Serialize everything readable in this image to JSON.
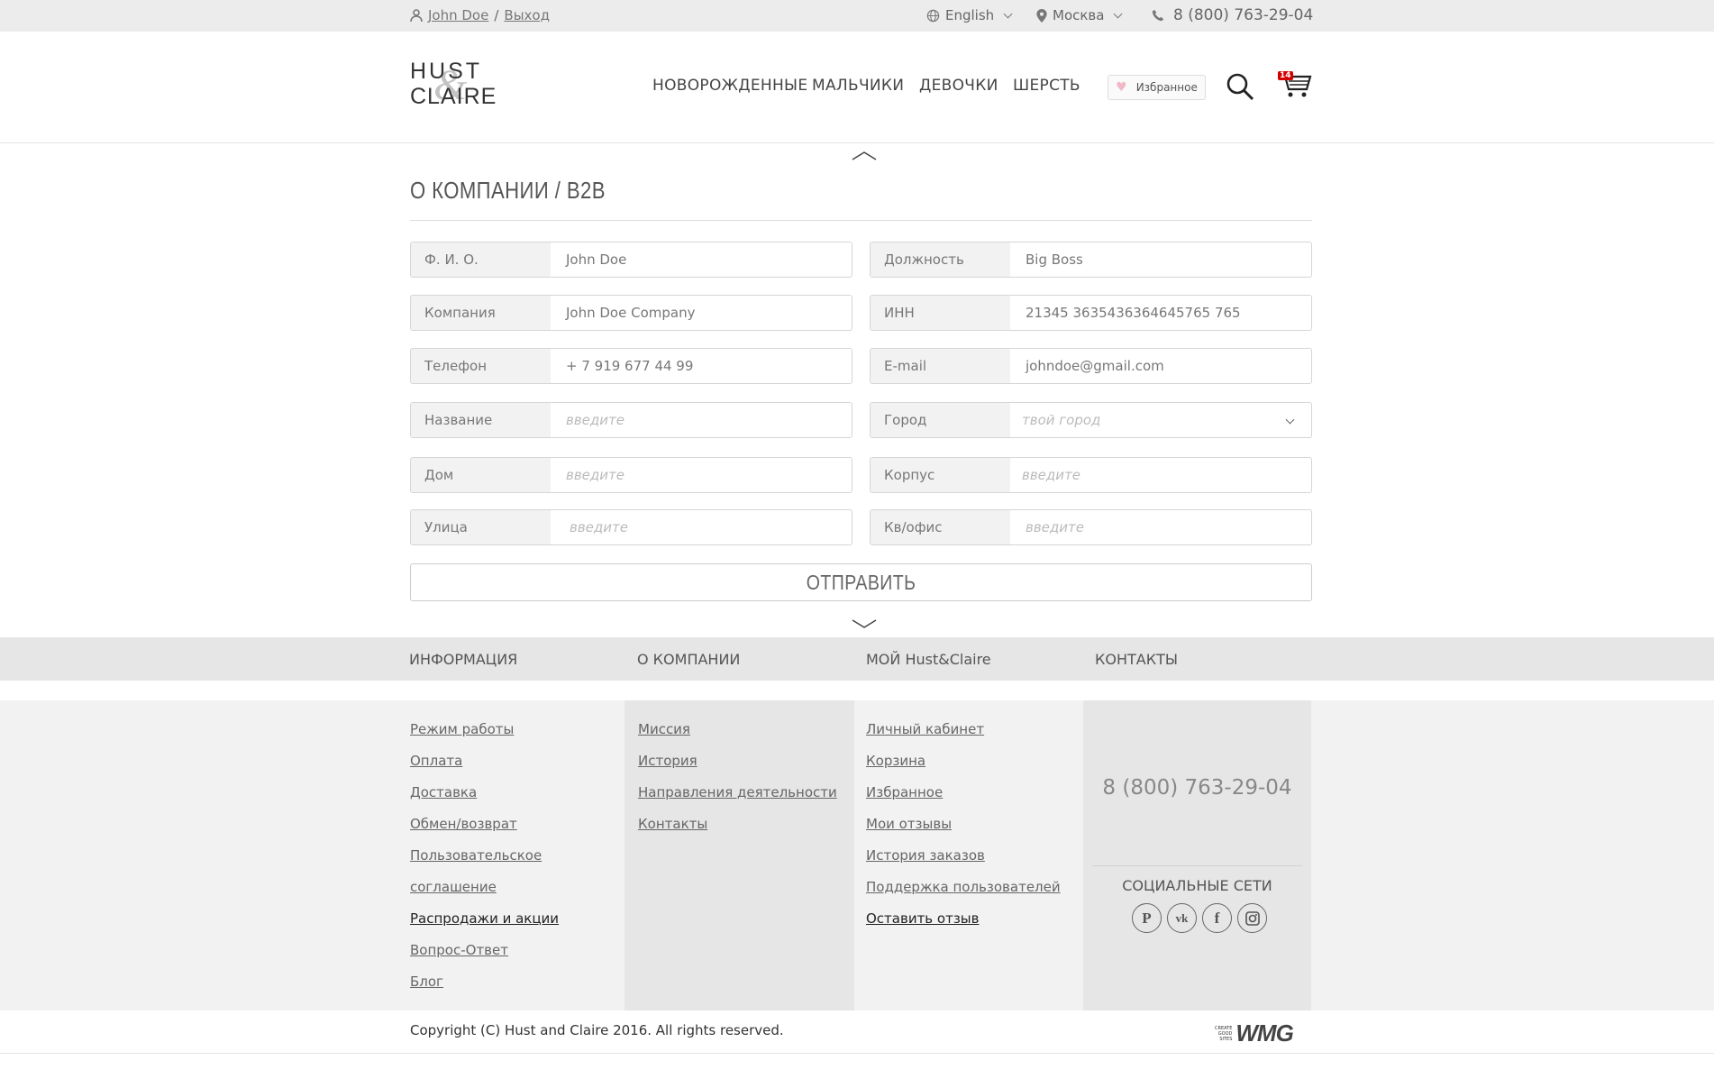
{
  "topbar": {
    "user_name": "John Doe",
    "separator": "/",
    "logout": "Выход",
    "language": "English",
    "city": "Москва",
    "phone": "8 (800) 763-29-04"
  },
  "header": {
    "logo_top": "HUST",
    "logo_amp": "&",
    "logo_bottom": "CLAIRE",
    "nav": [
      "НОВОРОЖДЕННЫЕ",
      "МАЛЬЧИКИ",
      "ДЕВОЧКИ",
      "ШЕРСТЬ"
    ],
    "favorites": "Избранное",
    "cart_count": "14"
  },
  "form": {
    "title": "О КОМПАНИИ / B2B",
    "fields_left": [
      {
        "label": "Ф. И. О.",
        "value": "John Doe",
        "placeholder": ""
      },
      {
        "label": "Компания",
        "value": "John Doe Company",
        "placeholder": ""
      },
      {
        "label": "Телефон",
        "value": "+ 7 919 677 44 99",
        "placeholder": ""
      },
      {
        "label": "Название",
        "value": "",
        "placeholder": "введите"
      },
      {
        "label": "Дом",
        "value": "",
        "placeholder": "введите"
      },
      {
        "label": "Улица",
        "value": "",
        "placeholder": "введите"
      }
    ],
    "fields_right": [
      {
        "label": "Должность",
        "value": "Big Boss",
        "placeholder": ""
      },
      {
        "label": "ИНН",
        "value": "21345 3635436364645765 765",
        "placeholder": ""
      },
      {
        "label": "E-mail",
        "value": "johndoe@gmail.com",
        "placeholder": ""
      },
      {
        "label": "Город",
        "value": "",
        "placeholder": "твой город"
      },
      {
        "label": "Корпус",
        "value": "",
        "placeholder": "введите"
      },
      {
        "label": "Кв/офис",
        "value": "",
        "placeholder": "введите"
      }
    ],
    "submit": "ОТПРАВИТЬ"
  },
  "footer": {
    "headings": [
      "ИНФОРМАЦИЯ",
      "О КОМПАНИИ",
      "МОЙ Hust&Claire",
      "КОНТАКТЫ"
    ],
    "info_links": [
      "Режим работы",
      "Оплата",
      "Доставка",
      "Обмен/возврат",
      "Пользовательское",
      "соглашение",
      "Распродажи и акции",
      "Вопрос-Ответ",
      "Блог"
    ],
    "company_links": [
      "Миссия",
      "История",
      "Направления деятельности",
      "Контакты"
    ],
    "my_links": [
      "Личный кабинет",
      "Корзина",
      "Избранное",
      "Мои отзывы",
      "История заказов",
      "Поддержка пользователей",
      "Оставить отзыв"
    ],
    "contact_phone": "8 (800) 763-29-04",
    "social_title": "СОЦИАЛЬНЫЕ СЕТИ",
    "social_icons": [
      "pinterest-icon",
      "vk-icon",
      "facebook-icon",
      "instagram-icon"
    ],
    "copyright": "Copyright (C) Hust and Claire 2016. All rights reserved.",
    "dev_tag_lines": [
      "CREATE",
      "GOOD",
      "SITES"
    ],
    "dev_name": "WMG"
  }
}
